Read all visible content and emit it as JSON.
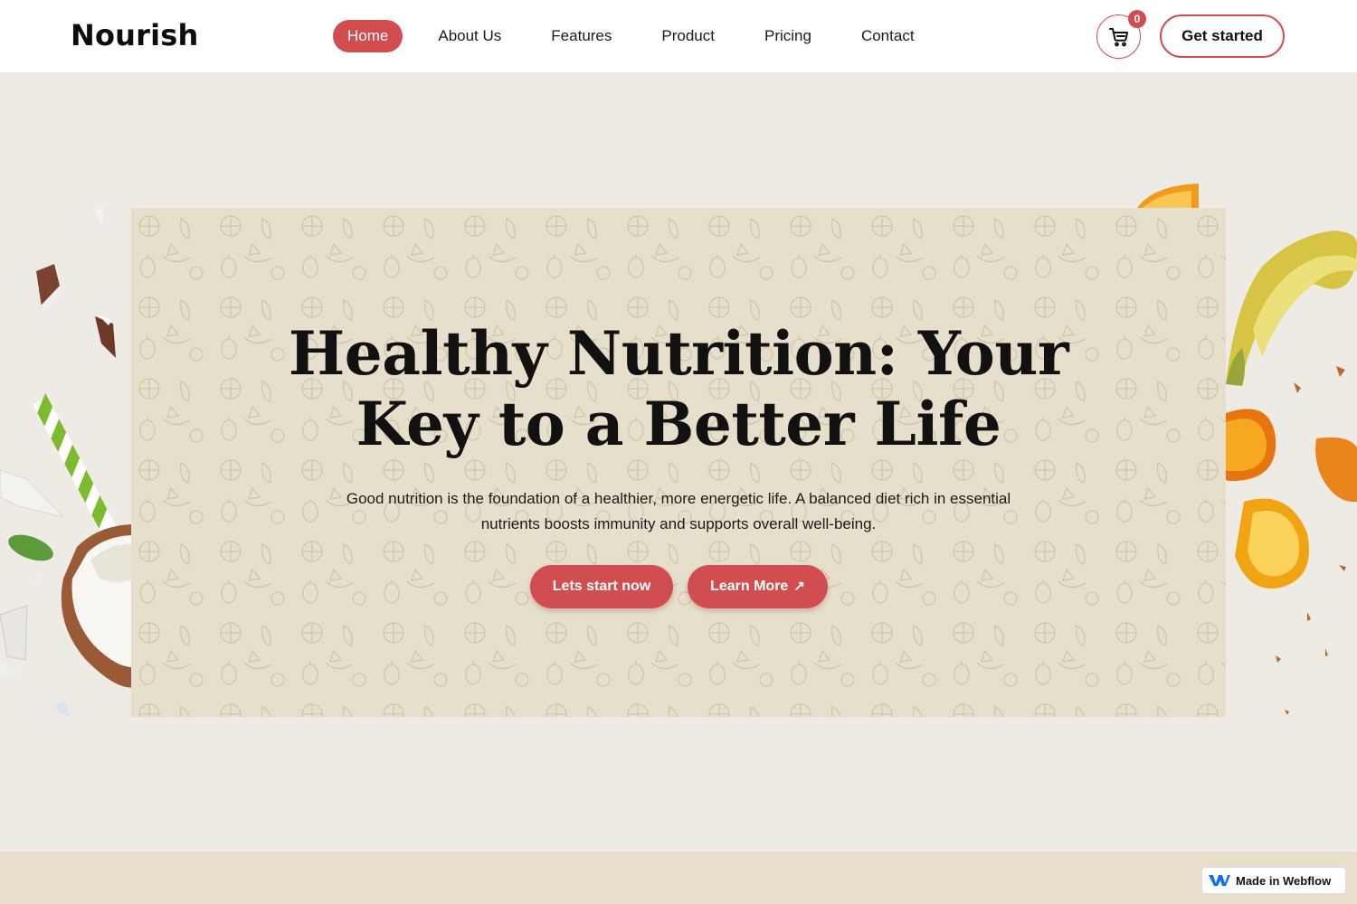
{
  "header": {
    "logo": "Nourish",
    "nav": [
      {
        "label": "Home",
        "active": true
      },
      {
        "label": "About Us"
      },
      {
        "label": "Features"
      },
      {
        "label": "Product"
      },
      {
        "label": "Pricing"
      },
      {
        "label": "Contact"
      }
    ],
    "cart_count": "0",
    "cta_label": "Get started"
  },
  "hero": {
    "title_line1": "Healthy Nutrition: Your",
    "title_line2": "Key to a Better Life",
    "subtitle_line1": "Good nutrition is the foundation of a healthier, more energetic life. A balanced diet rich in essential",
    "subtitle_line2": "nutrients boosts immunity and supports overall well-being.",
    "primary_button": "Lets start now",
    "secondary_button": "Learn More",
    "secondary_icon": "arrow-up-right-icon"
  },
  "badge": {
    "label": "Made in Webflow",
    "icon": "webflow-logo-icon"
  },
  "colors": {
    "accent": "#d24d4f",
    "page_bg": "#eeebe4",
    "card_bg": "#e6dfcc",
    "header_bg": "#ffffff"
  }
}
